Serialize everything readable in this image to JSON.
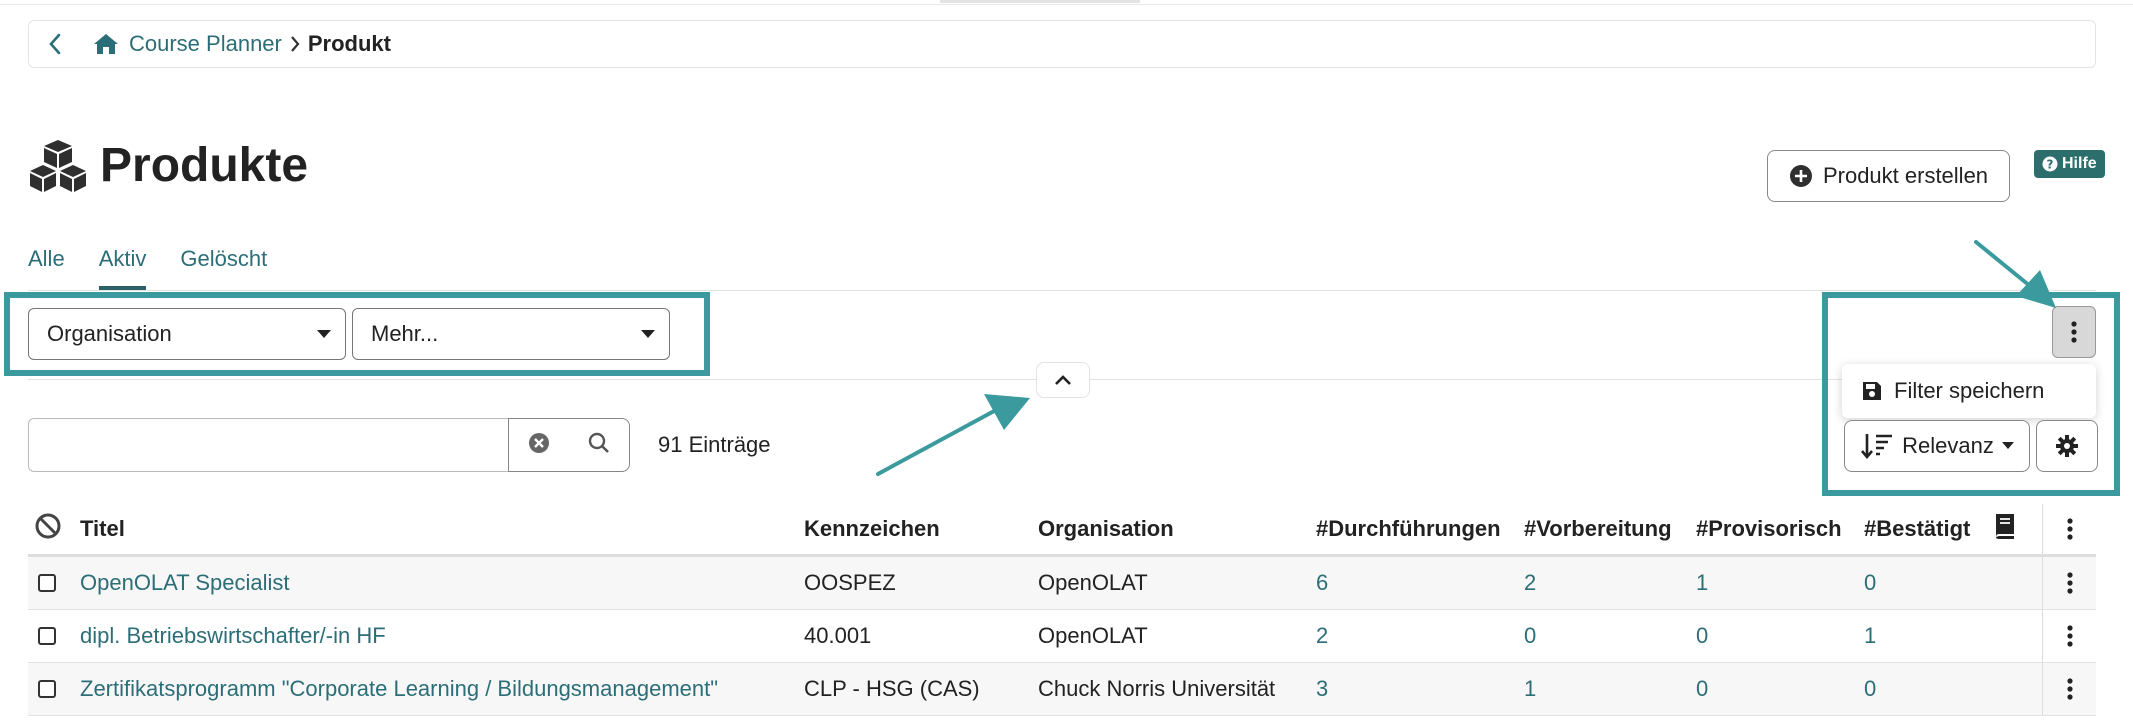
{
  "breadcrumb": {
    "home": "Course Planner",
    "current": "Produkt"
  },
  "page": {
    "title": "Produkte",
    "create_label": "Produkt erstellen",
    "help_label": "Hilfe"
  },
  "tabs": [
    {
      "label": "Alle"
    },
    {
      "label": "Aktiv"
    },
    {
      "label": "Gelöscht"
    }
  ],
  "filters": {
    "organisation": "Organisation",
    "more": "Mehr..."
  },
  "menu": {
    "save_filter": "Filter speichern"
  },
  "sort": {
    "label": "Relevanz"
  },
  "search": {
    "value": "",
    "count": "91 Einträge"
  },
  "table": {
    "headers": [
      "Titel",
      "Kennzeichen",
      "Organisation",
      "#Durchführungen",
      "#Vorbereitung",
      "#Provisorisch",
      "#Bestätigt"
    ],
    "rows": [
      {
        "title": "OpenOLAT Specialist",
        "code": "OOSPEZ",
        "org": "OpenOLAT",
        "d": "6",
        "v": "2",
        "p": "1",
        "b": "0"
      },
      {
        "title": "dipl. Betriebswirtschafter/-in HF",
        "code": "40.001",
        "org": "OpenOLAT",
        "d": "2",
        "v": "0",
        "p": "0",
        "b": "1"
      },
      {
        "title": "Zertifikatsprogramm \"Corporate Learning / Bildungsmanagement\"",
        "code": "CLP - HSG (CAS)",
        "org": "Chuck Norris Universität",
        "d": "3",
        "v": "1",
        "p": "0",
        "b": "0"
      }
    ]
  },
  "colors": {
    "accent": "#2c6e77",
    "highlight": "#3a9a9d",
    "help_bg": "#2c6e6b"
  }
}
